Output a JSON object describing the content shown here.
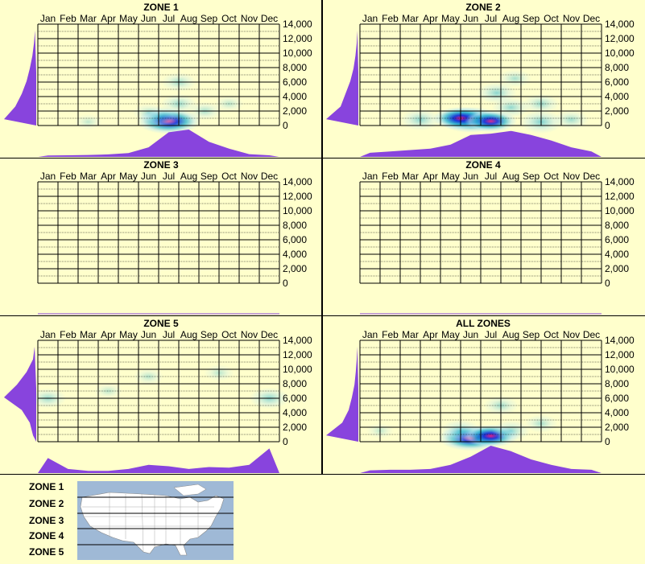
{
  "months": [
    "Jan",
    "Feb",
    "Mar",
    "Apr",
    "May",
    "Jun",
    "Jul",
    "Aug",
    "Sep",
    "Oct",
    "Nov",
    "Dec"
  ],
  "y_ticks": [
    "14,000",
    "12,000",
    "10,000",
    "8,000",
    "6,000",
    "4,000",
    "2,000",
    "0"
  ],
  "colors": {
    "background": "#ffffcc",
    "profile": "#8844dd",
    "grid": "#000000",
    "heat_low": "#bfe8f0",
    "heat_mid": "#1fb0d0",
    "heat_high": "#1a2fd8",
    "heat_peak": "#e0208a"
  },
  "chart_data": [
    {
      "type": "heatmap",
      "title": "ZONE 1",
      "x_labels": [
        "Jan",
        "Feb",
        "Mar",
        "Apr",
        "May",
        "Jun",
        "Jul",
        "Aug",
        "Sep",
        "Oct",
        "Nov",
        "Dec"
      ],
      "ylim": [
        0,
        14000
      ],
      "hotspots": [
        {
          "month": 7.0,
          "elev": 600,
          "intensity": 1.0
        },
        {
          "month": 6.6,
          "elev": 1200,
          "intensity": 0.45
        },
        {
          "month": 7.5,
          "elev": 3000,
          "intensity": 0.35
        },
        {
          "month": 7.5,
          "elev": 6000,
          "intensity": 0.3
        },
        {
          "month": 8.8,
          "elev": 2000,
          "intensity": 0.25
        },
        {
          "month": 6.0,
          "elev": 1800,
          "intensity": 0.2
        },
        {
          "month": 10.0,
          "elev": 3000,
          "intensity": 0.12
        },
        {
          "month": 3.0,
          "elev": 500,
          "intensity": 0.08
        }
      ],
      "month_profile": [
        0.05,
        0.06,
        0.07,
        0.09,
        0.14,
        0.35,
        0.9,
        1.0,
        0.55,
        0.3,
        0.1,
        0.06
      ],
      "elevation_profile": [
        1.0,
        0.65,
        0.45,
        0.3,
        0.2,
        0.12,
        0.07,
        0.04
      ]
    },
    {
      "type": "heatmap",
      "title": "ZONE 2",
      "x_labels": [
        "Jan",
        "Feb",
        "Mar",
        "Apr",
        "May",
        "Jun",
        "Jul",
        "Aug",
        "Sep",
        "Oct",
        "Nov",
        "Dec"
      ],
      "ylim": [
        0,
        14000
      ],
      "hotspots": [
        {
          "month": 6.0,
          "elev": 800,
          "intensity": 1.0
        },
        {
          "month": 5.5,
          "elev": 1000,
          "intensity": 0.7
        },
        {
          "month": 7.0,
          "elev": 600,
          "intensity": 0.6
        },
        {
          "month": 9.5,
          "elev": 500,
          "intensity": 0.55
        },
        {
          "month": 3.5,
          "elev": 800,
          "intensity": 0.45
        },
        {
          "month": 8.0,
          "elev": 2500,
          "intensity": 0.4
        },
        {
          "month": 7.3,
          "elev": 4500,
          "intensity": 0.45
        },
        {
          "month": 9.5,
          "elev": 3000,
          "intensity": 0.35
        },
        {
          "month": 8.2,
          "elev": 6500,
          "intensity": 0.25
        },
        {
          "month": 11.0,
          "elev": 800,
          "intensity": 0.3
        }
      ],
      "month_profile": [
        0.15,
        0.2,
        0.25,
        0.3,
        0.45,
        0.8,
        0.85,
        0.95,
        0.8,
        0.6,
        0.35,
        0.2
      ],
      "elevation_profile": [
        1.0,
        0.55,
        0.4,
        0.25,
        0.15,
        0.09,
        0.05,
        0.03
      ]
    },
    {
      "type": "heatmap",
      "title": "ZONE 3",
      "x_labels": [
        "Jan",
        "Feb",
        "Mar",
        "Apr",
        "May",
        "Jun",
        "Jul",
        "Aug",
        "Sep",
        "Oct",
        "Nov",
        "Dec"
      ],
      "ylim": [
        0,
        14000
      ],
      "hotspots": [],
      "month_profile": [],
      "elevation_profile": []
    },
    {
      "type": "heatmap",
      "title": "ZONE 4",
      "x_labels": [
        "Jan",
        "Feb",
        "Mar",
        "Apr",
        "May",
        "Jun",
        "Jul",
        "Aug",
        "Sep",
        "Oct",
        "Nov",
        "Dec"
      ],
      "ylim": [
        0,
        14000
      ],
      "hotspots": [],
      "month_profile": [],
      "elevation_profile": []
    },
    {
      "type": "heatmap",
      "title": "ZONE 5",
      "x_labels": [
        "Jan",
        "Feb",
        "Mar",
        "Apr",
        "May",
        "Jun",
        "Jul",
        "Aug",
        "Sep",
        "Oct",
        "Nov",
        "Dec"
      ],
      "ylim": [
        0,
        14000
      ],
      "hotspots": [
        {
          "month": 1.0,
          "elev": 6000,
          "intensity": 0.35
        },
        {
          "month": 12.0,
          "elev": 6000,
          "intensity": 0.45
        },
        {
          "month": 6.0,
          "elev": 9000,
          "intensity": 0.15
        },
        {
          "month": 9.5,
          "elev": 9500,
          "intensity": 0.15
        },
        {
          "month": 4.0,
          "elev": 7000,
          "intensity": 0.1
        }
      ],
      "month_profile": [
        0.55,
        0.15,
        0.08,
        0.08,
        0.15,
        0.3,
        0.25,
        0.15,
        0.22,
        0.2,
        0.3,
        0.9
      ],
      "elevation_profile": [
        0.1,
        0.2,
        0.45,
        1.0,
        0.6,
        0.3,
        0.1,
        0.05
      ]
    },
    {
      "type": "heatmap",
      "title": "ALL ZONES",
      "x_labels": [
        "Jan",
        "Feb",
        "Mar",
        "Apr",
        "May",
        "Jun",
        "Jul",
        "Aug",
        "Sep",
        "Oct",
        "Nov",
        "Dec"
      ],
      "ylim": [
        0,
        14000
      ],
      "hotspots": [
        {
          "month": 6.0,
          "elev": 500,
          "intensity": 1.0
        },
        {
          "month": 7.0,
          "elev": 800,
          "intensity": 0.7
        },
        {
          "month": 5.5,
          "elev": 1500,
          "intensity": 0.5
        },
        {
          "month": 8.0,
          "elev": 1500,
          "intensity": 0.4
        },
        {
          "month": 7.5,
          "elev": 5000,
          "intensity": 0.3
        },
        {
          "month": 9.5,
          "elev": 2500,
          "intensity": 0.25
        },
        {
          "month": 1.5,
          "elev": 1500,
          "intensity": 0.08
        }
      ],
      "month_profile": [
        0.1,
        0.12,
        0.12,
        0.15,
        0.3,
        0.6,
        1.0,
        0.8,
        0.5,
        0.3,
        0.15,
        0.12
      ],
      "elevation_profile": [
        1.0,
        0.5,
        0.3,
        0.2,
        0.12,
        0.08,
        0.05,
        0.03
      ]
    }
  ],
  "legend": {
    "zones": [
      "ZONE 1",
      "ZONE 2",
      "ZONE 3",
      "ZONE 4",
      "ZONE 5"
    ],
    "map_icon": "us-map-zones"
  }
}
